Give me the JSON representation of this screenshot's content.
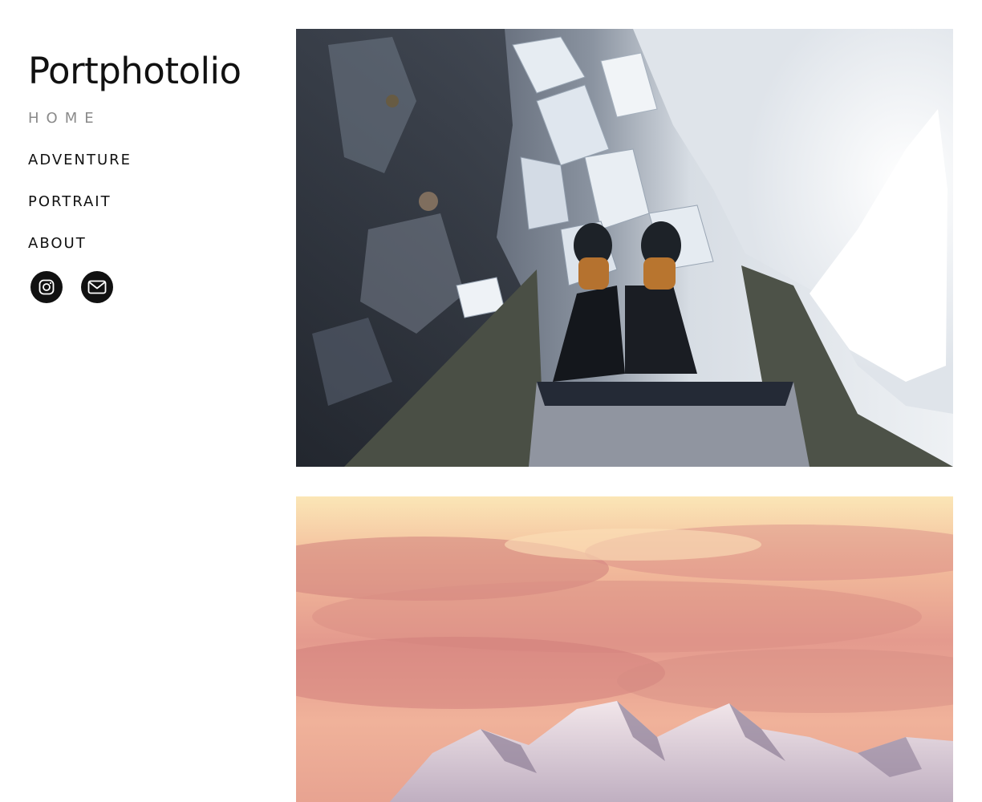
{
  "site": {
    "title": "Portphotolio"
  },
  "nav": {
    "items": [
      {
        "label": "HOME",
        "active": true
      },
      {
        "label": "ADVENTURE",
        "active": false
      },
      {
        "label": "PORTRAIT",
        "active": false
      },
      {
        "label": "ABOUT",
        "active": false
      }
    ]
  },
  "social": {
    "icons": [
      "instagram-icon",
      "mail-icon"
    ]
  },
  "colors": {
    "text": "#111111",
    "nav_active": "#8a8a8a",
    "background": "#ffffff"
  }
}
